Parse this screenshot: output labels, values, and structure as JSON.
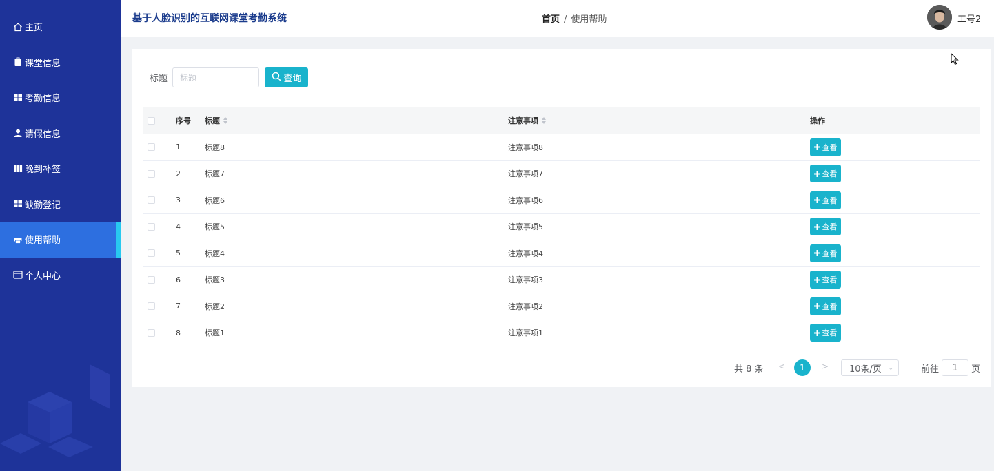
{
  "app": {
    "title": "基于人脸识别的互联网课堂考勤系统"
  },
  "breadcrumb": {
    "home": "首页",
    "separator": "/",
    "current": "使用帮助"
  },
  "user": {
    "name": "工号2"
  },
  "sidebar": {
    "items": [
      {
        "label": "主页",
        "icon": "home-icon",
        "active": false
      },
      {
        "label": "课堂信息",
        "icon": "clipboard-icon",
        "active": false
      },
      {
        "label": "考勤信息",
        "icon": "grid-icon",
        "active": false
      },
      {
        "label": "请假信息",
        "icon": "user-icon",
        "active": false
      },
      {
        "label": "晚到补签",
        "icon": "book-icon",
        "active": false
      },
      {
        "label": "缺勤登记",
        "icon": "grid-icon",
        "active": false
      },
      {
        "label": "使用帮助",
        "icon": "print-icon",
        "active": true
      },
      {
        "label": "个人中心",
        "icon": "card-icon",
        "active": false
      }
    ]
  },
  "search": {
    "label": "标题",
    "placeholder": "标题",
    "button_label": "查询"
  },
  "table": {
    "headers": {
      "no": "序号",
      "title": "标题",
      "note": "注意事项",
      "op": "操作"
    },
    "view_label": "查看",
    "rows": [
      {
        "no": "1",
        "title": "标题8",
        "note": "注意事项8"
      },
      {
        "no": "2",
        "title": "标题7",
        "note": "注意事项7"
      },
      {
        "no": "3",
        "title": "标题6",
        "note": "注意事项6"
      },
      {
        "no": "4",
        "title": "标题5",
        "note": "注意事项5"
      },
      {
        "no": "5",
        "title": "标题4",
        "note": "注意事项4"
      },
      {
        "no": "6",
        "title": "标题3",
        "note": "注意事项3"
      },
      {
        "no": "7",
        "title": "标题2",
        "note": "注意事项2"
      },
      {
        "no": "8",
        "title": "标题1",
        "note": "注意事项1"
      }
    ]
  },
  "pagination": {
    "total": "共 8 条",
    "prev": "<",
    "current_page": "1",
    "next": ">",
    "page_size": "10条/页",
    "goto_label": "前往",
    "goto_value": "1",
    "goto_unit": "页"
  },
  "colors": {
    "sidebar": "#1e3399",
    "active": "#2d6fe0",
    "accent": "#19b3cc"
  }
}
